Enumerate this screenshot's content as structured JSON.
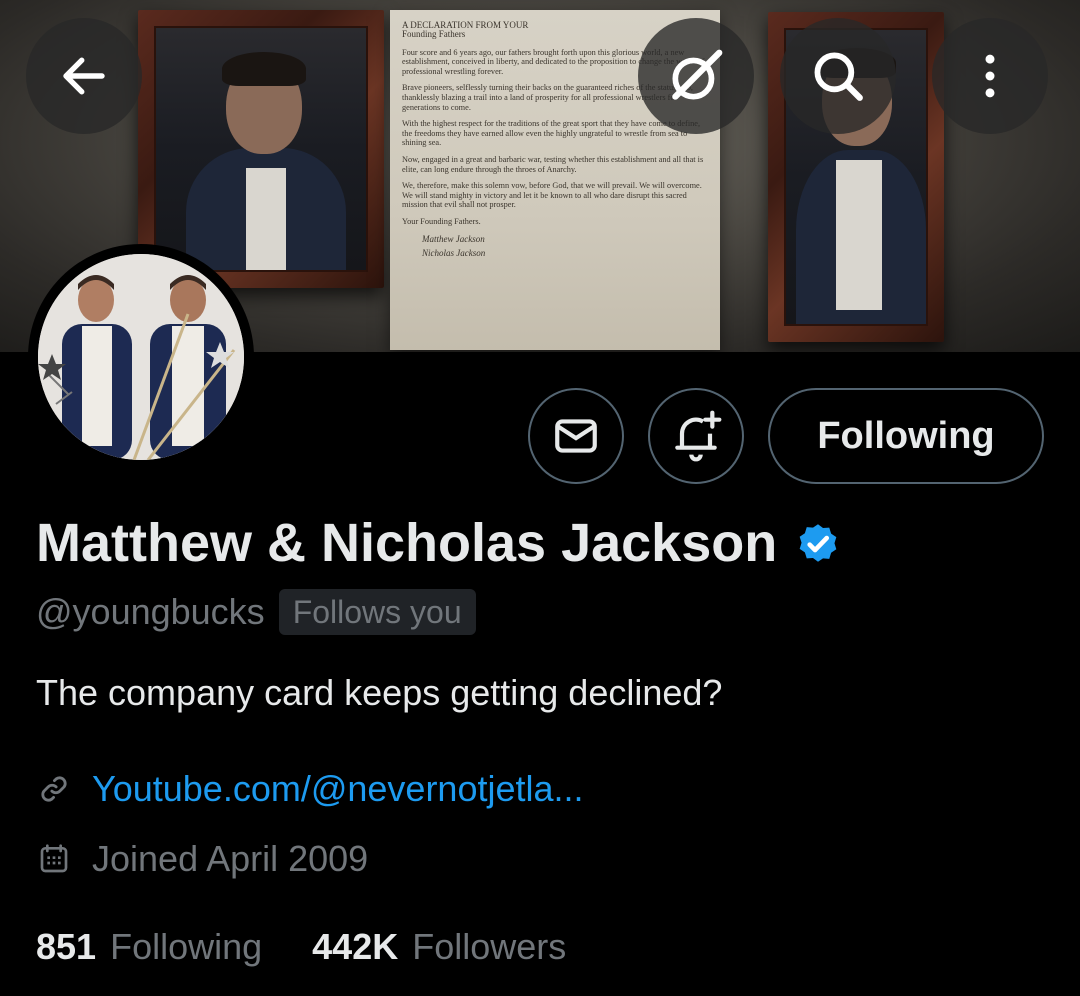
{
  "header": {
    "back_icon": "arrow-left-icon",
    "grok_icon": "grok-slash-icon",
    "search_icon": "search-icon",
    "more_icon": "more-vertical-icon"
  },
  "banner": {
    "letter_title": "A DECLARATION FROM YOUR",
    "letter_subtitle": "Founding Fathers",
    "paragraphs": [
      "Four score and 6 years ago, our fathers brought forth upon this glorious world, a new establishment, conceived in liberty, and dedicated to the proposition to change the world of professional wrestling forever.",
      "Brave pioneers, selflessly turning their backs on the guaranteed riches of the status quo, thanklessly blazing a trail into a land of prosperity for all professional wrestlers for generations to come.",
      "With the highest respect for the traditions of the great sport that they have come to define, the freedoms they have earned allow even the highly ungrateful to wrestle from sea to shining sea.",
      "Now, engaged in a great and barbaric war, testing whether this establishment and all that is elite, can long endure through the throes of Anarchy.",
      "We, therefore, make this solemn vow, before God, that we will prevail. We will overcome. We will stand mighty in victory and let it be known to all who dare disrupt this sacred mission that evil shall not prosper."
    ],
    "closing": "Your Founding Fathers.",
    "signature_1": "Matthew Jackson",
    "signature_2": "Nicholas Jackson"
  },
  "actions": {
    "message_icon": "mail-icon",
    "notify_icon": "bell-plus-icon",
    "follow_label": "Following"
  },
  "profile": {
    "display_name": "Matthew & Nicholas Jackson",
    "verified_icon": "verified-badge-icon",
    "handle": "@youngbucks",
    "follows_you": "Follows you",
    "bio": "The company card keeps getting declined?",
    "link_icon": "link-icon",
    "link": "Youtube.com/@nevernotjetla...",
    "calendar_icon": "calendar-icon",
    "joined": "Joined April 2009"
  },
  "stats": {
    "following_count": "851",
    "following_label": "Following",
    "followers_count": "442K",
    "followers_label": "Followers"
  },
  "colors": {
    "accent": "#1d9bf0",
    "muted": "#71767b",
    "border": "#536471",
    "background": "#000000"
  }
}
